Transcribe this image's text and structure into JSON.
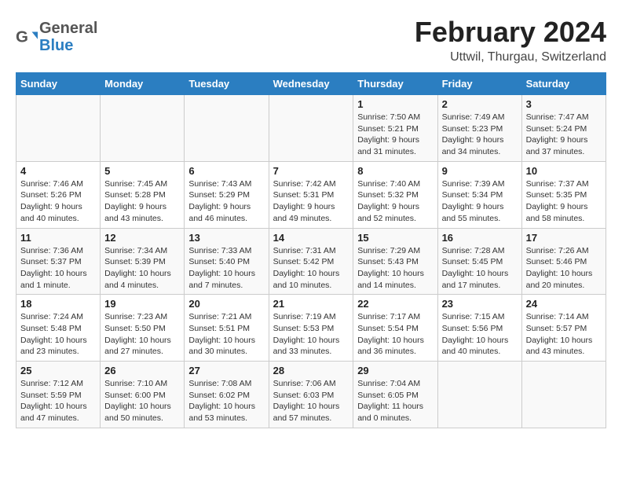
{
  "header": {
    "logo_line1": "General",
    "logo_line2": "Blue",
    "title": "February 2024",
    "subtitle": "Uttwil, Thurgau, Switzerland"
  },
  "days_of_week": [
    "Sunday",
    "Monday",
    "Tuesday",
    "Wednesday",
    "Thursday",
    "Friday",
    "Saturday"
  ],
  "weeks": [
    [
      {
        "day": "",
        "info": ""
      },
      {
        "day": "",
        "info": ""
      },
      {
        "day": "",
        "info": ""
      },
      {
        "day": "",
        "info": ""
      },
      {
        "day": "1",
        "info": "Sunrise: 7:50 AM\nSunset: 5:21 PM\nDaylight: 9 hours and 31 minutes."
      },
      {
        "day": "2",
        "info": "Sunrise: 7:49 AM\nSunset: 5:23 PM\nDaylight: 9 hours and 34 minutes."
      },
      {
        "day": "3",
        "info": "Sunrise: 7:47 AM\nSunset: 5:24 PM\nDaylight: 9 hours and 37 minutes."
      }
    ],
    [
      {
        "day": "4",
        "info": "Sunrise: 7:46 AM\nSunset: 5:26 PM\nDaylight: 9 hours and 40 minutes."
      },
      {
        "day": "5",
        "info": "Sunrise: 7:45 AM\nSunset: 5:28 PM\nDaylight: 9 hours and 43 minutes."
      },
      {
        "day": "6",
        "info": "Sunrise: 7:43 AM\nSunset: 5:29 PM\nDaylight: 9 hours and 46 minutes."
      },
      {
        "day": "7",
        "info": "Sunrise: 7:42 AM\nSunset: 5:31 PM\nDaylight: 9 hours and 49 minutes."
      },
      {
        "day": "8",
        "info": "Sunrise: 7:40 AM\nSunset: 5:32 PM\nDaylight: 9 hours and 52 minutes."
      },
      {
        "day": "9",
        "info": "Sunrise: 7:39 AM\nSunset: 5:34 PM\nDaylight: 9 hours and 55 minutes."
      },
      {
        "day": "10",
        "info": "Sunrise: 7:37 AM\nSunset: 5:35 PM\nDaylight: 9 hours and 58 minutes."
      }
    ],
    [
      {
        "day": "11",
        "info": "Sunrise: 7:36 AM\nSunset: 5:37 PM\nDaylight: 10 hours and 1 minute."
      },
      {
        "day": "12",
        "info": "Sunrise: 7:34 AM\nSunset: 5:39 PM\nDaylight: 10 hours and 4 minutes."
      },
      {
        "day": "13",
        "info": "Sunrise: 7:33 AM\nSunset: 5:40 PM\nDaylight: 10 hours and 7 minutes."
      },
      {
        "day": "14",
        "info": "Sunrise: 7:31 AM\nSunset: 5:42 PM\nDaylight: 10 hours and 10 minutes."
      },
      {
        "day": "15",
        "info": "Sunrise: 7:29 AM\nSunset: 5:43 PM\nDaylight: 10 hours and 14 minutes."
      },
      {
        "day": "16",
        "info": "Sunrise: 7:28 AM\nSunset: 5:45 PM\nDaylight: 10 hours and 17 minutes."
      },
      {
        "day": "17",
        "info": "Sunrise: 7:26 AM\nSunset: 5:46 PM\nDaylight: 10 hours and 20 minutes."
      }
    ],
    [
      {
        "day": "18",
        "info": "Sunrise: 7:24 AM\nSunset: 5:48 PM\nDaylight: 10 hours and 23 minutes."
      },
      {
        "day": "19",
        "info": "Sunrise: 7:23 AM\nSunset: 5:50 PM\nDaylight: 10 hours and 27 minutes."
      },
      {
        "day": "20",
        "info": "Sunrise: 7:21 AM\nSunset: 5:51 PM\nDaylight: 10 hours and 30 minutes."
      },
      {
        "day": "21",
        "info": "Sunrise: 7:19 AM\nSunset: 5:53 PM\nDaylight: 10 hours and 33 minutes."
      },
      {
        "day": "22",
        "info": "Sunrise: 7:17 AM\nSunset: 5:54 PM\nDaylight: 10 hours and 36 minutes."
      },
      {
        "day": "23",
        "info": "Sunrise: 7:15 AM\nSunset: 5:56 PM\nDaylight: 10 hours and 40 minutes."
      },
      {
        "day": "24",
        "info": "Sunrise: 7:14 AM\nSunset: 5:57 PM\nDaylight: 10 hours and 43 minutes."
      }
    ],
    [
      {
        "day": "25",
        "info": "Sunrise: 7:12 AM\nSunset: 5:59 PM\nDaylight: 10 hours and 47 minutes."
      },
      {
        "day": "26",
        "info": "Sunrise: 7:10 AM\nSunset: 6:00 PM\nDaylight: 10 hours and 50 minutes."
      },
      {
        "day": "27",
        "info": "Sunrise: 7:08 AM\nSunset: 6:02 PM\nDaylight: 10 hours and 53 minutes."
      },
      {
        "day": "28",
        "info": "Sunrise: 7:06 AM\nSunset: 6:03 PM\nDaylight: 10 hours and 57 minutes."
      },
      {
        "day": "29",
        "info": "Sunrise: 7:04 AM\nSunset: 6:05 PM\nDaylight: 11 hours and 0 minutes."
      },
      {
        "day": "",
        "info": ""
      },
      {
        "day": "",
        "info": ""
      }
    ]
  ]
}
